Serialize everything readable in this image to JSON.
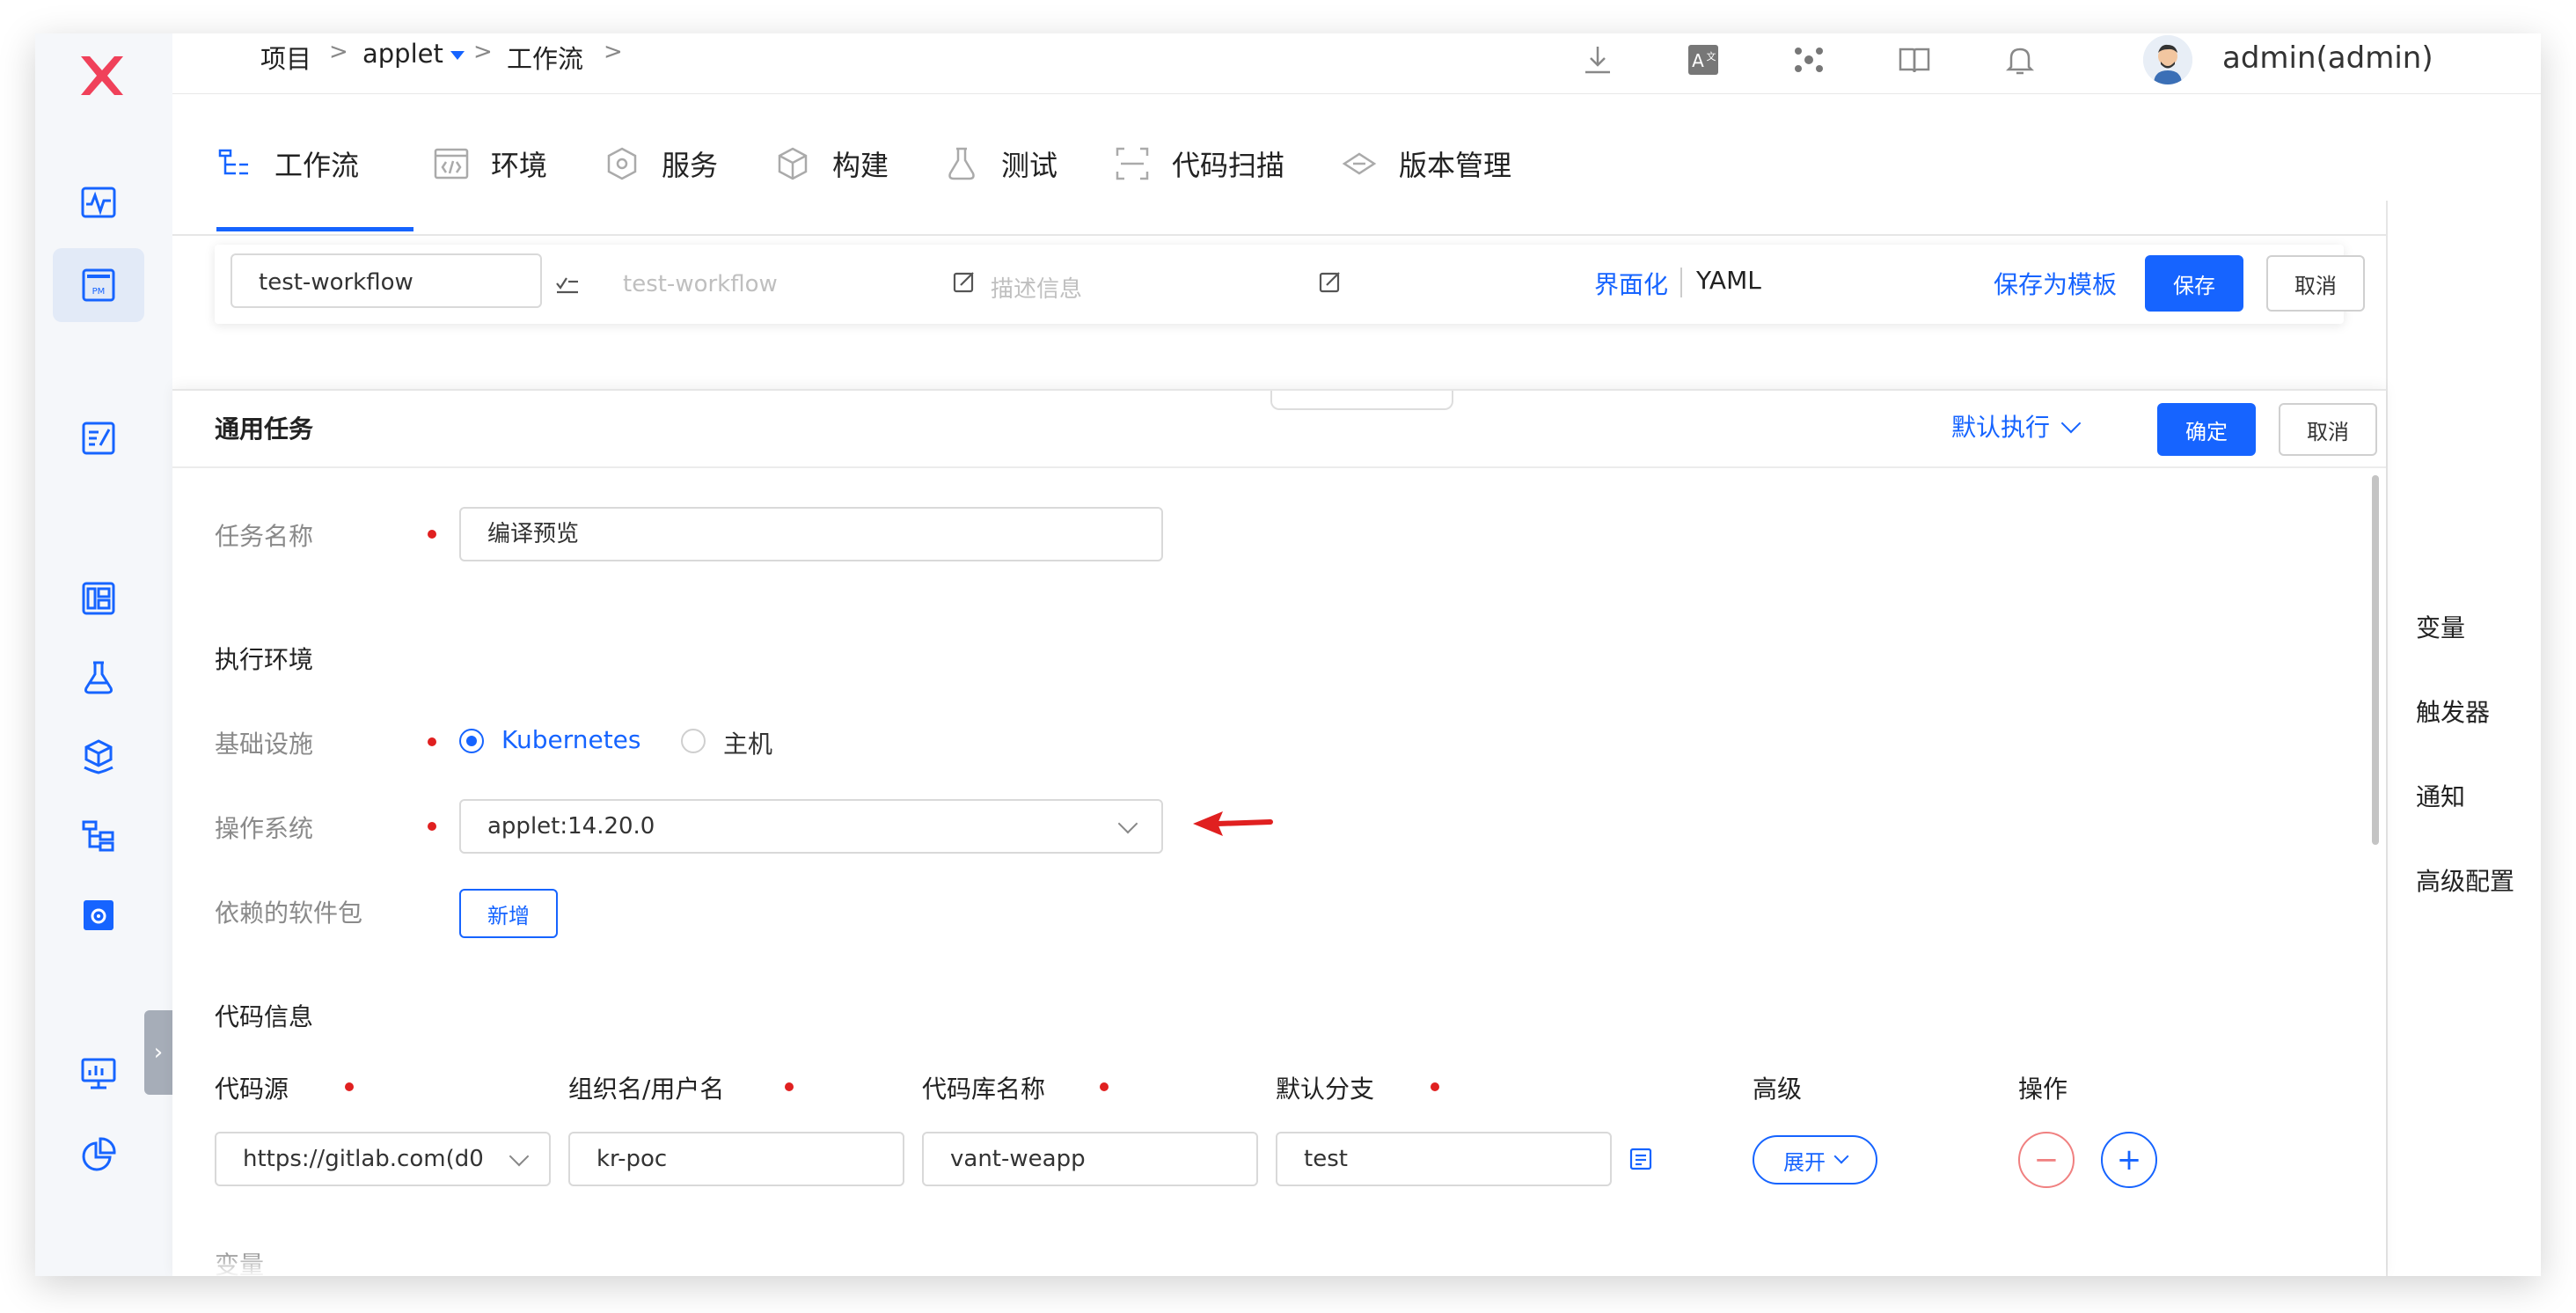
{
  "breadcrumb": {
    "items": [
      "项目",
      "applet",
      "工作流"
    ],
    "separator": ">"
  },
  "user": {
    "name": "admin(admin)"
  },
  "tabs": [
    "工作流",
    "环境",
    "服务",
    "构建",
    "测试",
    "代码扫描",
    "版本管理"
  ],
  "editor": {
    "name_value": "test-workflow",
    "display_name_placeholder": "test-workflow",
    "description_placeholder": "描述信息",
    "mode_ui": "界面化",
    "mode_yaml": "YAML",
    "save_template": "保存为模板",
    "save": "保存",
    "cancel": "取消"
  },
  "right_panel": [
    "变量",
    "触发器",
    "通知",
    "高级配置"
  ],
  "task": {
    "title": "通用任务",
    "run_mode": "默认执行",
    "confirm": "确定",
    "cancel": "取消",
    "name_label": "任务名称",
    "name_value": "编译预览",
    "env_section": "执行环境",
    "infra_label": "基础设施",
    "infra_options": [
      "Kubernetes",
      "主机"
    ],
    "infra_selected": "Kubernetes",
    "os_label": "操作系统",
    "os_value": "applet:14.20.0",
    "deps_label": "依赖的软件包",
    "add_button": "新增",
    "code_section": "代码信息",
    "code_headers": [
      "代码源",
      "组织名/用户名",
      "代码库名称",
      "默认分支",
      "高级",
      "操作"
    ],
    "code_row": {
      "source": "https://gitlab.com(d0",
      "org": "kr-poc",
      "repo": "vant-weapp",
      "branch": "test",
      "advanced": "展开"
    },
    "vars_section": "变量"
  },
  "colors": {
    "accent": "#1664ff",
    "required": "#e02020",
    "logo": "#f0415a",
    "annotation": "#e02020"
  }
}
